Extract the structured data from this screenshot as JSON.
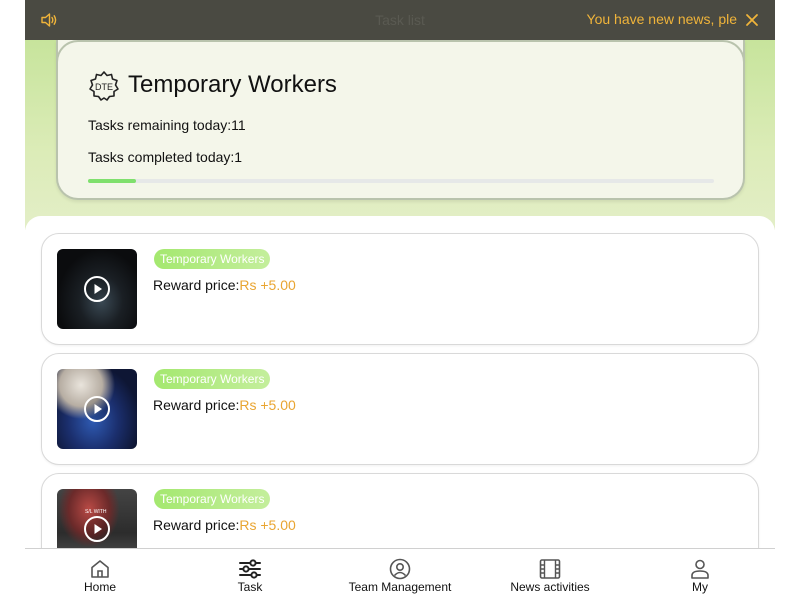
{
  "topbar": {
    "title": "Task list",
    "marquee": "You have new news, ple",
    "speaker_icon": "speaker-icon",
    "close_icon": "close-icon"
  },
  "hero": {
    "logo_text": "DTE",
    "title": "Temporary Workers",
    "remaining": "Tasks remaining today:11",
    "completed": "Tasks completed today:1",
    "progress_percent": 7.7
  },
  "tasks": [
    {
      "tag": "Temporary Workers",
      "reward_label": "Reward price:",
      "reward_value": "Rs +5.00",
      "thumb_text": ""
    },
    {
      "tag": "Temporary Workers",
      "reward_label": "Reward price:",
      "reward_value": "Rs +5.00",
      "thumb_text": ""
    },
    {
      "tag": "Temporary Workers",
      "reward_label": "Reward price:",
      "reward_value": "Rs +5.00",
      "thumb_text": "S/L WITH"
    }
  ],
  "nav": [
    {
      "label": "Home",
      "icon": "home-icon"
    },
    {
      "label": "Task",
      "icon": "sliders-icon"
    },
    {
      "label": "Team Management",
      "icon": "user-circle-icon"
    },
    {
      "label": "News activities",
      "icon": "film-icon"
    },
    {
      "label": "My",
      "icon": "person-icon"
    }
  ],
  "colors": {
    "topbar_bg": "#4a4a42",
    "marquee": "#f0b43a",
    "price": "#e9a532",
    "progress": "#7fe06d",
    "tag": "#a4e86f"
  }
}
